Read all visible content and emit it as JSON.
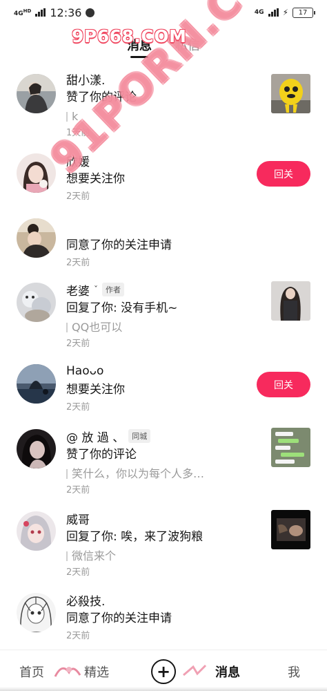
{
  "status_bar": {
    "network_left": "4G",
    "network_left_sub": "HD",
    "time": "12:36",
    "network_right": "4G",
    "battery": "17"
  },
  "watermarks": {
    "top": "9P668.COM",
    "diagonal": "91PORN.COM"
  },
  "tabs": [
    {
      "label": "消息",
      "active": true
    },
    {
      "label": "私信",
      "active": false
    }
  ],
  "messages": [
    {
      "name": "甜小漾.",
      "action": "赞了你的评论",
      "quote": "k",
      "time": "1天前",
      "right": "thumbnail"
    },
    {
      "name": "欣媛",
      "action": "想要关注你",
      "time": "2天前",
      "right": "button",
      "button_label": "回关"
    },
    {
      "name": "",
      "action": "同意了你的关注申请",
      "time": "2天前",
      "right": "none"
    },
    {
      "name": "老婆",
      "badge": "作者",
      "action": "回复了你: 没有手机~",
      "quote": "QQ也可以",
      "time": "2天前",
      "right": "thumbnail"
    },
    {
      "name": "Haoᴗo",
      "action": "想要关注你",
      "time": "2天前",
      "right": "button",
      "button_label": "回关"
    },
    {
      "name": "@ 放 過 、",
      "badge": "同城",
      "action": "赞了你的评论",
      "quote": "笑什么，你以为每个人多…",
      "time": "2天前",
      "right": "thumbnail"
    },
    {
      "name": "威哥",
      "action": "回复了你: 唉，来了波狗粮",
      "quote": "微信来个",
      "time": "2天前",
      "right": "thumbnail"
    },
    {
      "name": "必殺技.",
      "action": "同意了你的关注申请",
      "time": "2天前",
      "right": "none"
    }
  ],
  "bottom_nav": {
    "home": "首页",
    "featured": "精选",
    "plus": "+",
    "messages": "消息",
    "me": "我"
  },
  "colors": {
    "accent": "#f72a5d",
    "text_primary": "#161616",
    "text_secondary": "#9a9a9a"
  }
}
